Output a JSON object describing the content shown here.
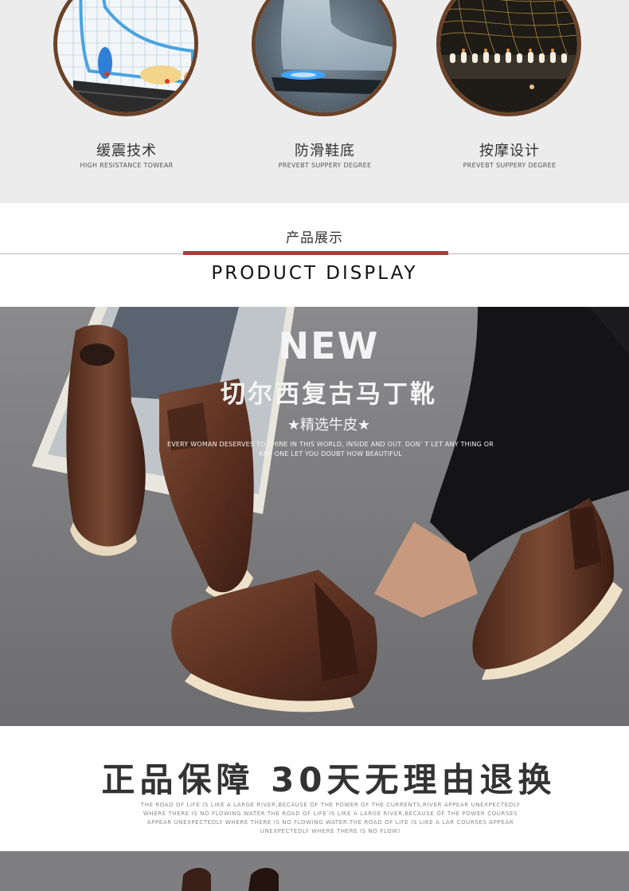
{
  "features": [
    {
      "title": "缓震技术",
      "subtitle": "HIGH RESISTANCE TOWEAR",
      "icon": "cushioning-insole-image"
    },
    {
      "title": "防滑鞋底",
      "subtitle": "PREVEBT SUPPERY DEGREE",
      "icon": "anti-slip-sole-image"
    },
    {
      "title": "按摩设计",
      "subtitle": "PREVEBT SUPPERY DEGREE",
      "icon": "massage-insole-image"
    }
  ],
  "product_display": {
    "title_cn": "产品展示",
    "title_en": "PRODUCT DISPLAY",
    "accent_color": "#a1413b"
  },
  "hero": {
    "badge": "NEW",
    "title": "切尔西复古马丁靴",
    "subtitle": "★精选牛皮★",
    "copy": "EVERY WOMAN DESERVES TO SHINE IN THIS WORLD, INSIDE AND OUT. DON’ T LET ANY THING OR ANY ONE LET YOU DOUBT HOW BEAUTIFUL",
    "image": "brown-chelsea-boots-photo"
  },
  "guarantee": {
    "title": "正品保障   30天无理由退换",
    "copy": "THE ROAD OF LIFE IS LIKE A LARGE RIVER,BECAUSE OF THE POWER OF THE CURRENTS,RIVER APPEAR UNEXPECTEDLY WHERE THERE IS NO FLOWING WATER.THE ROAD OF LIFE IS LIKE A LARGE RIVER,BECAUSE OF THE POWER COURSES APPEAR UNEXPECTEDLY WHERE THERE IS NO FLOWING WATER.THE ROAD OF LIFE IS LIKE A LAR COURSES APPEAR UNEXPECTEDLY WHERE THERE IS NO FLOW!"
  }
}
